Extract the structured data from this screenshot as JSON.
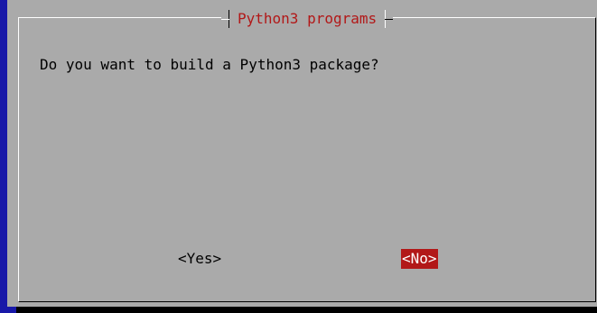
{
  "dialog": {
    "title": "Python3 programs",
    "message": "Do you want to build a Python3 package?",
    "buttons": {
      "yes_label": "<Yes>",
      "no_label": "<No>",
      "selected": "no"
    }
  },
  "colors": {
    "background": "#1818a8",
    "dialog_bg": "#aaaaaa",
    "title_text": "#b21818",
    "selected_button_bg": "#b21818",
    "selected_button_text": "#ffffff"
  }
}
